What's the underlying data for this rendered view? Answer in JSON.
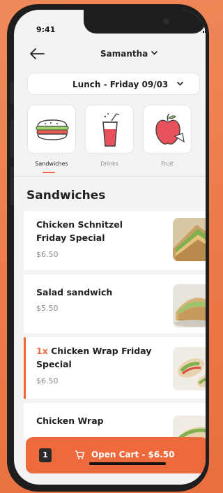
{
  "status": {
    "time": "9:41"
  },
  "header": {
    "user_name": "Samantha"
  },
  "meal_selector": {
    "label": "Lunch - Friday 09/03"
  },
  "categories": [
    {
      "label": "Sandwiches",
      "icon": "sandwich-icon",
      "active": true
    },
    {
      "label": "Drinks",
      "icon": "drink-icon",
      "active": false
    },
    {
      "label": "Fruit",
      "icon": "apple-icon",
      "active": false
    }
  ],
  "section_title": "Sandwiches",
  "items": [
    {
      "name": "Chicken Schnitzel Friday Special",
      "price": "$6.50",
      "qty": ""
    },
    {
      "name": "Salad sandwich",
      "price": "$5.50",
      "qty": ""
    },
    {
      "name": "Chicken Wrap Friday Special",
      "price": "$6.50",
      "qty": "1x"
    },
    {
      "name": "Chicken Wrap",
      "price": "",
      "qty": ""
    }
  ],
  "cart": {
    "count": "1",
    "label": "Open Cart - $6.50"
  },
  "colors": {
    "accent": "#ec6a3c",
    "background": "#f08a5b"
  }
}
